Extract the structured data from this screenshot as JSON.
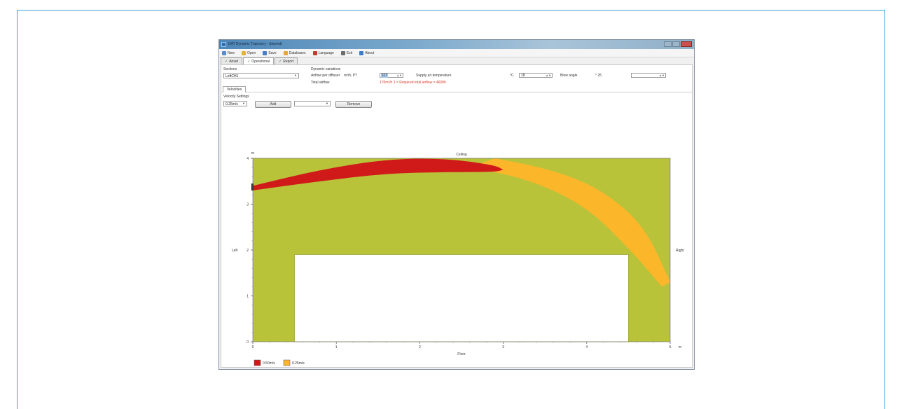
{
  "window": {
    "title": "DAT Dynamic Trajectory - (blurred)"
  },
  "menu": [
    {
      "label": "New",
      "icon": "new-file-icon",
      "color": "#5b8bd0"
    },
    {
      "label": "Open",
      "icon": "open-folder-icon",
      "color": "#e2b33b"
    },
    {
      "label": "Save",
      "icon": "save-icon",
      "color": "#4c7ec7"
    },
    {
      "label": "Databases",
      "icon": "database-icon",
      "color": "#e7a63a"
    },
    {
      "label": "Language",
      "icon": "language-flag-icon",
      "color": "#c23b2e"
    },
    {
      "label": "Exit",
      "icon": "exit-icon",
      "color": "#6d6d6d"
    },
    {
      "label": "About",
      "icon": "help-icon",
      "color": "#3f7cc7"
    }
  ],
  "tabs": [
    {
      "label": "Airset",
      "checked": true
    },
    {
      "label": "Operational",
      "checked": true,
      "active": true
    },
    {
      "label": "Report",
      "checked": true
    }
  ],
  "sections": {
    "label": "Sections",
    "value": "LeftCH1"
  },
  "dynamic": {
    "heading": "Dynamic variations",
    "airflow_label": "Airflow per diffuser",
    "airflow_unit": "m³/h, P?",
    "airflow_value": "117",
    "supply_label": "Supply air temperature",
    "supply_unit": "°C",
    "supply_value": "18",
    "blow_label": "Blow angle",
    "blow_unit": "° 25",
    "blow_value": "",
    "total_label": "Total airflow",
    "total_value": "170m³/h 1 = Required total airflow = 4600h"
  },
  "subtab": "Velocities",
  "velocity": {
    "heading": "Velocity Settings",
    "selected": "0.25m/s",
    "add_label": "Add",
    "remove_label": "Remove",
    "secondary_value": ""
  },
  "chart_data": {
    "type": "area",
    "title": "Ceiling",
    "xlabel": "Floor",
    "ylabel_left": "Left",
    "ylabel_right": "Right",
    "x_unit": "m",
    "y_unit": "m",
    "xlim": [
      0,
      5
    ],
    "ylim": [
      0,
      4
    ],
    "x_ticks": [
      "0",
      "1",
      "2",
      "3",
      "4",
      "5"
    ],
    "y_ticks": [
      "0",
      "1",
      "2",
      "3",
      "4"
    ],
    "background_color": "#b8c33a",
    "obstacle": {
      "x0": 0.5,
      "x1": 4.5,
      "y0": 0,
      "y1": 1.9,
      "color": "#ffffff"
    },
    "series": [
      {
        "name": "0.25m/s",
        "color": "#fbb62a",
        "upper": [
          [
            2.9,
            4.0
          ],
          [
            3.6,
            3.75
          ],
          [
            4.2,
            3.3
          ],
          [
            4.7,
            2.5
          ],
          [
            5.0,
            1.3
          ]
        ],
        "lower": [
          [
            2.6,
            3.8
          ],
          [
            3.3,
            3.55
          ],
          [
            4.0,
            2.95
          ],
          [
            4.55,
            1.95
          ],
          [
            4.9,
            1.2
          ]
        ]
      },
      {
        "name": "0.50m/s",
        "color": "#d01a1a",
        "upper": [
          [
            0.0,
            3.4
          ],
          [
            0.8,
            3.75
          ],
          [
            1.6,
            3.98
          ],
          [
            2.3,
            4.0
          ],
          [
            2.9,
            3.85
          ],
          [
            3.0,
            3.75
          ]
        ],
        "lower": [
          [
            0.0,
            3.3
          ],
          [
            0.8,
            3.5
          ],
          [
            1.6,
            3.67
          ],
          [
            2.3,
            3.7
          ],
          [
            2.9,
            3.7
          ],
          [
            3.0,
            3.75
          ]
        ]
      }
    ],
    "legend": {
      "position": "bottom-left"
    }
  }
}
